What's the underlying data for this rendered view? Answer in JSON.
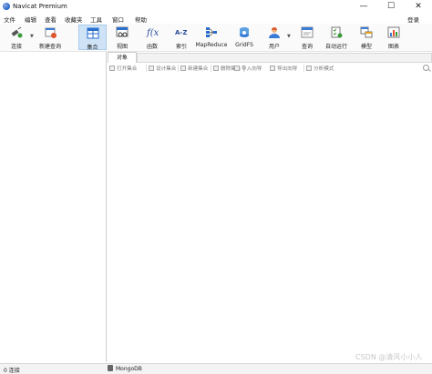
{
  "window": {
    "title": "Navicat Premium",
    "minimize": "—",
    "maximize": "☐",
    "close": "✕"
  },
  "menu": {
    "items": [
      "文件",
      "编辑",
      "查看",
      "收藏夹",
      "工具",
      "窗口",
      "帮助"
    ],
    "login": "登录"
  },
  "toolbar": {
    "connect": "连接",
    "new_query": "新建查询",
    "collection": "集合",
    "view": "视图",
    "function": "函数",
    "index": "索引",
    "mapreduce": "MapReduce",
    "gridfs": "GridFS",
    "user": "用户",
    "query": "查询",
    "automation": "自动运行",
    "model": "模型",
    "chart": "图表"
  },
  "tabs": {
    "object": "对象"
  },
  "object_toolbar": {
    "open": "打开集合",
    "design": "设计集合",
    "new": "新建集合",
    "delete": "删除集合",
    "import": "导入向导",
    "export": "导出向导",
    "analyze": "分析模式"
  },
  "status": {
    "connections": "0 连接",
    "db_type": "MongoDB"
  },
  "watermark": "CSDN @清风小小人",
  "colors": {
    "accent": "#2a6fcf",
    "active_tab": "#cfe3f7"
  }
}
